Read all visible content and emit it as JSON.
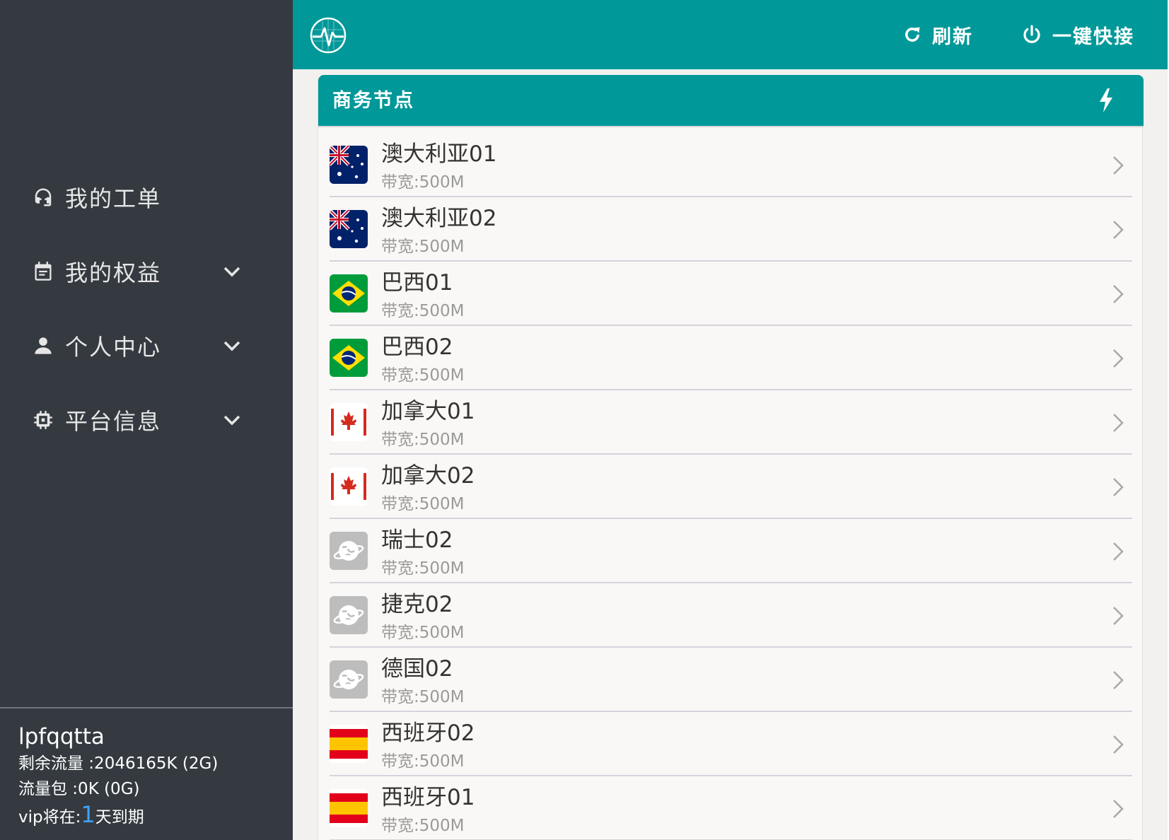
{
  "sidebar": {
    "items": [
      {
        "label": "我的工单",
        "icon": "support-agent-icon",
        "has_dropdown": false
      },
      {
        "label": "我的权益",
        "icon": "calendar-icon",
        "has_dropdown": true
      },
      {
        "label": "个人中心",
        "icon": "person-icon",
        "has_dropdown": true
      },
      {
        "label": "平台信息",
        "icon": "chip-icon",
        "has_dropdown": true
      }
    ]
  },
  "user": {
    "name": "lpfqqtta",
    "remaining_traffic": "剩余流量 :2046165K (2G)",
    "traffic_package": "流量包 :0K (0G)",
    "vip_prefix": "vip将在:",
    "vip_days": "1",
    "vip_suffix": "天到期"
  },
  "header": {
    "logo_icon": "pulse-logo-icon",
    "refresh_label": "刷新",
    "connect_label": "一键快接"
  },
  "panel": {
    "title": "商务节点",
    "nodes": [
      {
        "name": "澳大利亚01",
        "bandwidth": "带宽:500M",
        "flag": "australia"
      },
      {
        "name": "澳大利亚02",
        "bandwidth": "带宽:500M",
        "flag": "australia"
      },
      {
        "name": "巴西01",
        "bandwidth": "带宽:500M",
        "flag": "brazil"
      },
      {
        "name": "巴西02",
        "bandwidth": "带宽:500M",
        "flag": "brazil"
      },
      {
        "name": "加拿大01",
        "bandwidth": "带宽:500M",
        "flag": "canada"
      },
      {
        "name": "加拿大02",
        "bandwidth": "带宽:500M",
        "flag": "canada"
      },
      {
        "name": "瑞士02",
        "bandwidth": "带宽:500M",
        "flag": "globe"
      },
      {
        "name": "捷克02",
        "bandwidth": "带宽:500M",
        "flag": "globe"
      },
      {
        "name": "德国02",
        "bandwidth": "带宽:500M",
        "flag": "globe"
      },
      {
        "name": "西班牙02",
        "bandwidth": "带宽:500M",
        "flag": "spain"
      },
      {
        "name": "西班牙01",
        "bandwidth": "带宽:500M",
        "flag": "spain"
      }
    ]
  },
  "colors": {
    "teal": "#009899",
    "sidebar_bg": "#343a40",
    "vip_blue": "#3ea3ff"
  }
}
